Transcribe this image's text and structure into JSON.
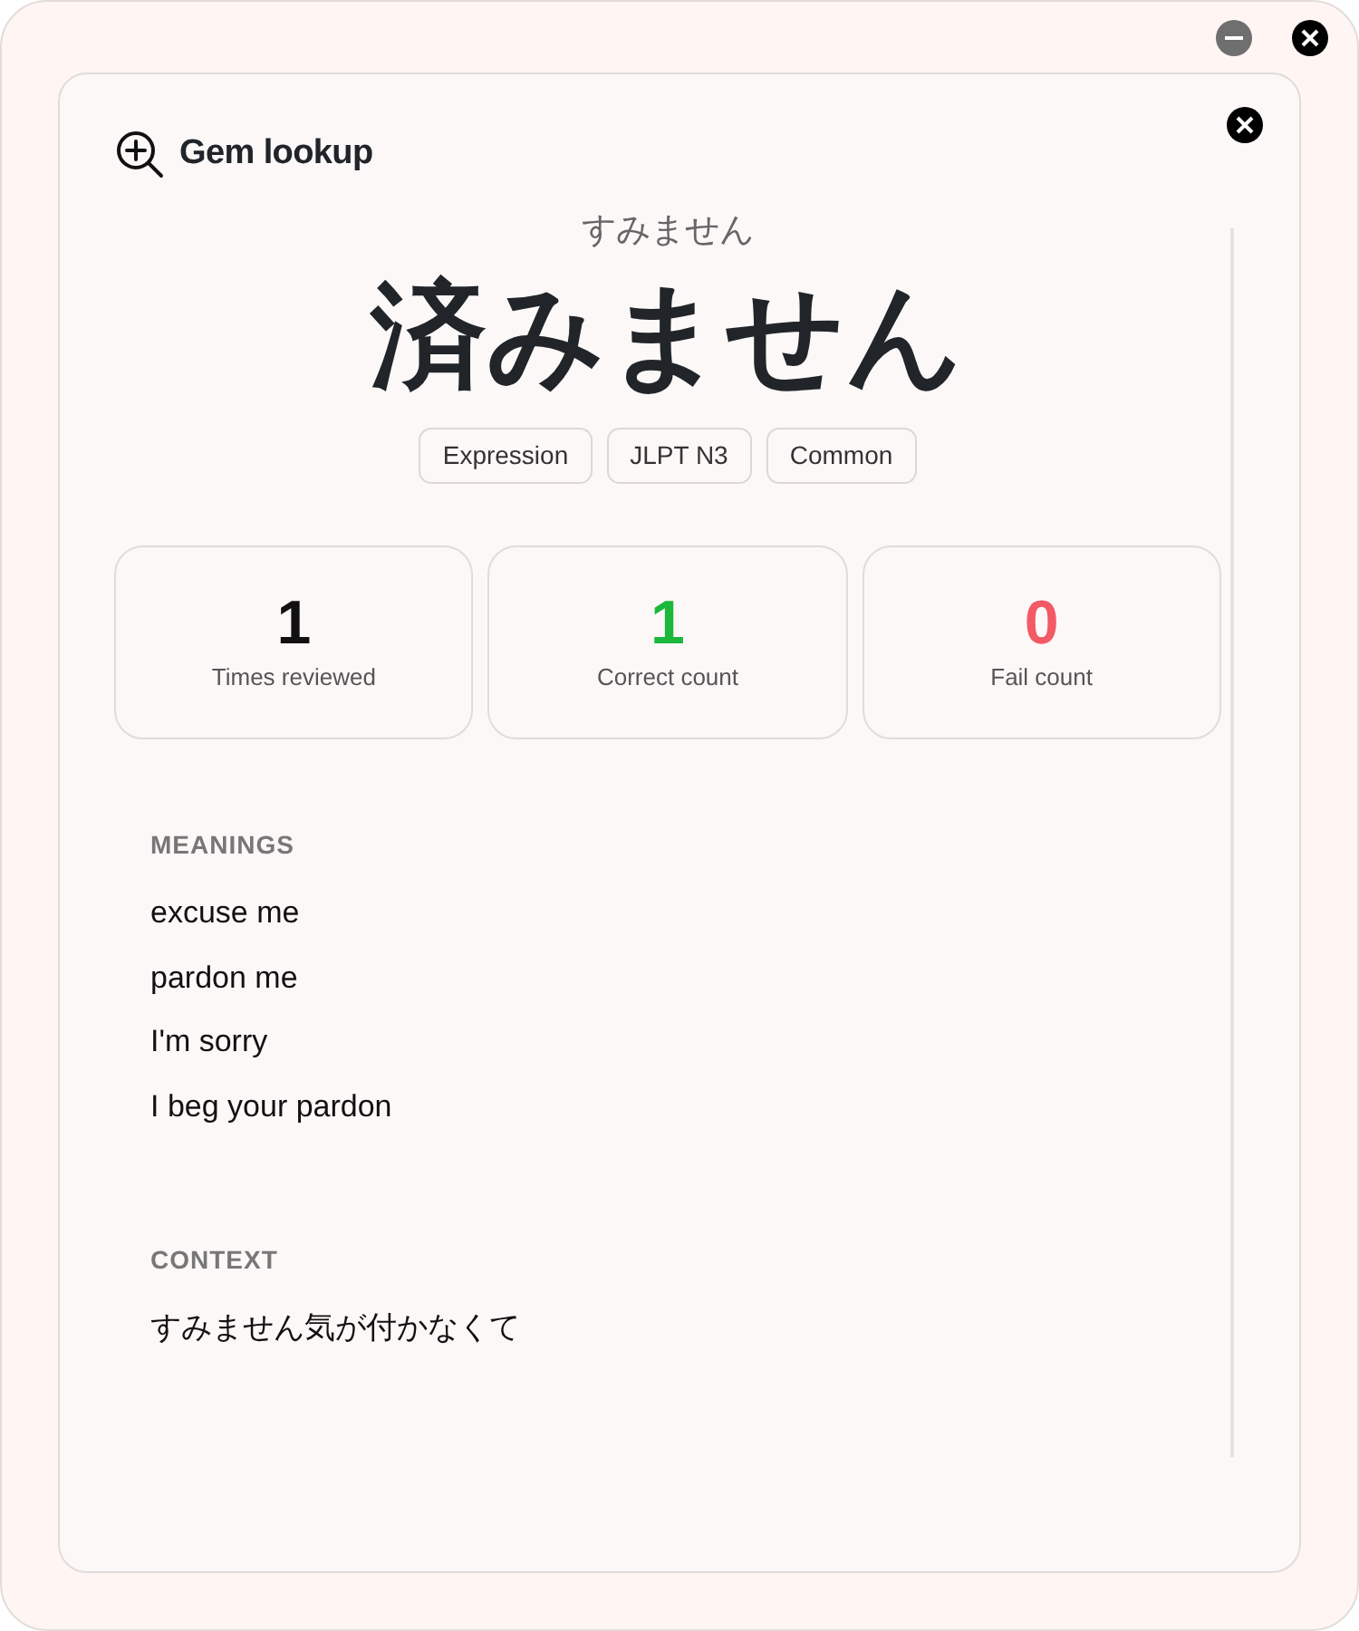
{
  "window": {
    "controls": [
      {
        "kind": "minimize"
      },
      {
        "kind": "close"
      }
    ]
  },
  "panel": {
    "title": "Gem lookup"
  },
  "word": {
    "reading": "すみません",
    "headword": "済みません",
    "tags": [
      "Expression",
      "JLPT N3",
      "Common"
    ]
  },
  "stats": [
    {
      "value": "1",
      "label": "Times reviewed",
      "color": "#111111"
    },
    {
      "value": "1",
      "label": "Correct count",
      "color": "#1bb83c"
    },
    {
      "value": "0",
      "label": "Fail count",
      "color": "#f25a66"
    }
  ],
  "meanings": {
    "heading": "MEANINGS",
    "items": [
      "excuse me",
      "pardon me",
      "I'm sorry",
      "I beg your pardon"
    ]
  },
  "context": {
    "heading": "CONTEXT",
    "text": "すみません気が付かなくて"
  }
}
